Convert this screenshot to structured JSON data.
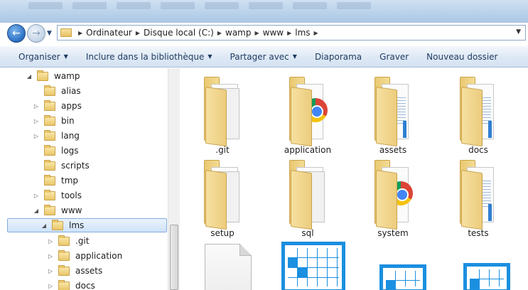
{
  "window": {
    "breadcrumbs": [
      "Ordinateur",
      "Disque local (C:)",
      "wamp",
      "www",
      "lms"
    ]
  },
  "command_bar": {
    "items": [
      {
        "label": "Organiser",
        "has_menu": true
      },
      {
        "label": "Inclure dans la bibliothèque",
        "has_menu": true
      },
      {
        "label": "Partager avec",
        "has_menu": true
      },
      {
        "label": "Diaporama",
        "has_menu": false
      },
      {
        "label": "Graver",
        "has_menu": false
      },
      {
        "label": "Nouveau dossier",
        "has_menu": false
      }
    ]
  },
  "nav_tree": [
    {
      "label": "wamp",
      "expanded": true
    },
    {
      "label": "alias",
      "expanded": null
    },
    {
      "label": "apps",
      "expanded": false
    },
    {
      "label": "bin",
      "expanded": false
    },
    {
      "label": "lang",
      "expanded": false
    },
    {
      "label": "logs",
      "expanded": null
    },
    {
      "label": "scripts",
      "expanded": null
    },
    {
      "label": "tmp",
      "expanded": null
    },
    {
      "label": "tools",
      "expanded": false
    },
    {
      "label": "www",
      "expanded": true
    },
    {
      "label": "lms",
      "expanded": true,
      "selected": true
    },
    {
      "label": ".git",
      "expanded": false
    },
    {
      "label": "application",
      "expanded": false
    },
    {
      "label": "assets",
      "expanded": false
    },
    {
      "label": "docs",
      "expanded": false
    }
  ],
  "content_items": [
    {
      "label": ".git",
      "icon": "folder-icon"
    },
    {
      "label": "application",
      "icon": "chrome-folder-icon"
    },
    {
      "label": "assets",
      "icon": "document-folder-icon"
    },
    {
      "label": "docs",
      "icon": "document-folder-icon"
    },
    {
      "label": "setup",
      "icon": "folder-icon"
    },
    {
      "label": "sql",
      "icon": "folder-icon"
    },
    {
      "label": "system",
      "icon": "chrome-folder-icon"
    },
    {
      "label": "tests",
      "icon": "document-folder-icon"
    }
  ],
  "colors": {
    "accent": "#1b8fe0",
    "folder": "#e9c66a",
    "selection": "#cfe3f9"
  }
}
